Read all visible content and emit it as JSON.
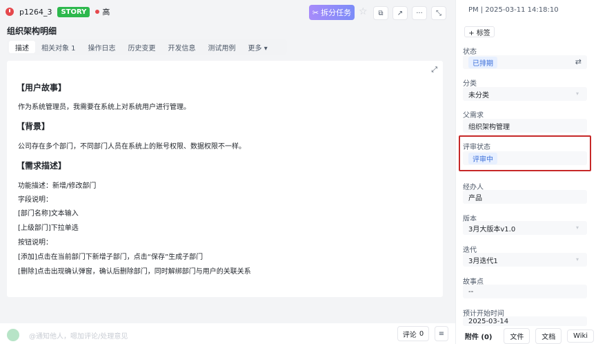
{
  "header": {
    "id": "p1264_3",
    "type_tag": "STORY",
    "priority": "高",
    "split_label": "拆分任务",
    "split_icon": "✂",
    "star_icon": "☆",
    "icons": [
      "⧉",
      "↗",
      "···",
      "⤡"
    ]
  },
  "page_title": "组织架构明细",
  "tabs": [
    "描述",
    "相关对象 1",
    "操作日志",
    "历史变更",
    "开发信息",
    "测试用例",
    "更多 ▾"
  ],
  "content": {
    "expand_icon": "⤢",
    "user_story_title": "【用户故事】",
    "user_story_text": "作为系统管理员，我需要在系统上对系统用户进行管理。",
    "background_title": "【背景】",
    "background_text": "公司存在多个部门，不同部门人员在系统上的账号权限、数据权限不一样。",
    "requirement_title": "【需求描述】",
    "lines": [
      "功能描述：新增/修改部门",
      "字段说明：",
      "[部门名称]文本输入",
      "[上级部门]下拉单选",
      "按钮说明：",
      "[添加]点击在当前部门下新增子部门，点击“保存”生成子部门",
      "[删除]点击出现确认弹窗，确认后删除部门，同时解绑部门与用户的关联关系"
    ]
  },
  "bottom": {
    "placeholder": "@通知他人，嗯加评论/处理意见",
    "comment_label": "评论",
    "comment_count": "0",
    "comment_icon": "≡"
  },
  "panel": {
    "meta": "PM | 2025-03-11 14:18:10",
    "add_tag": "+ 标签",
    "status_label": "状态",
    "status_value": "已排期",
    "swap_icon": "⇄",
    "category_label": "分类",
    "category_value": "未分类",
    "parent_label": "父需求",
    "parent_value": "组织架构管理",
    "review_label": "评审状态",
    "review_value": "评审中",
    "owner_label": "经办人",
    "owner_value": "产品",
    "version_label": "版本",
    "version_value": "3月大版本v1.0",
    "iteration_label": "迭代",
    "iteration_value": "3月迭代1",
    "points_label": "故事点",
    "points_value": "--",
    "start_label": "预计开始时间",
    "start_value": "2025-03-14",
    "chevron": "▾",
    "bottom_tabs": [
      "附件 (0)",
      "文件",
      "文档",
      "Wiki"
    ]
  }
}
